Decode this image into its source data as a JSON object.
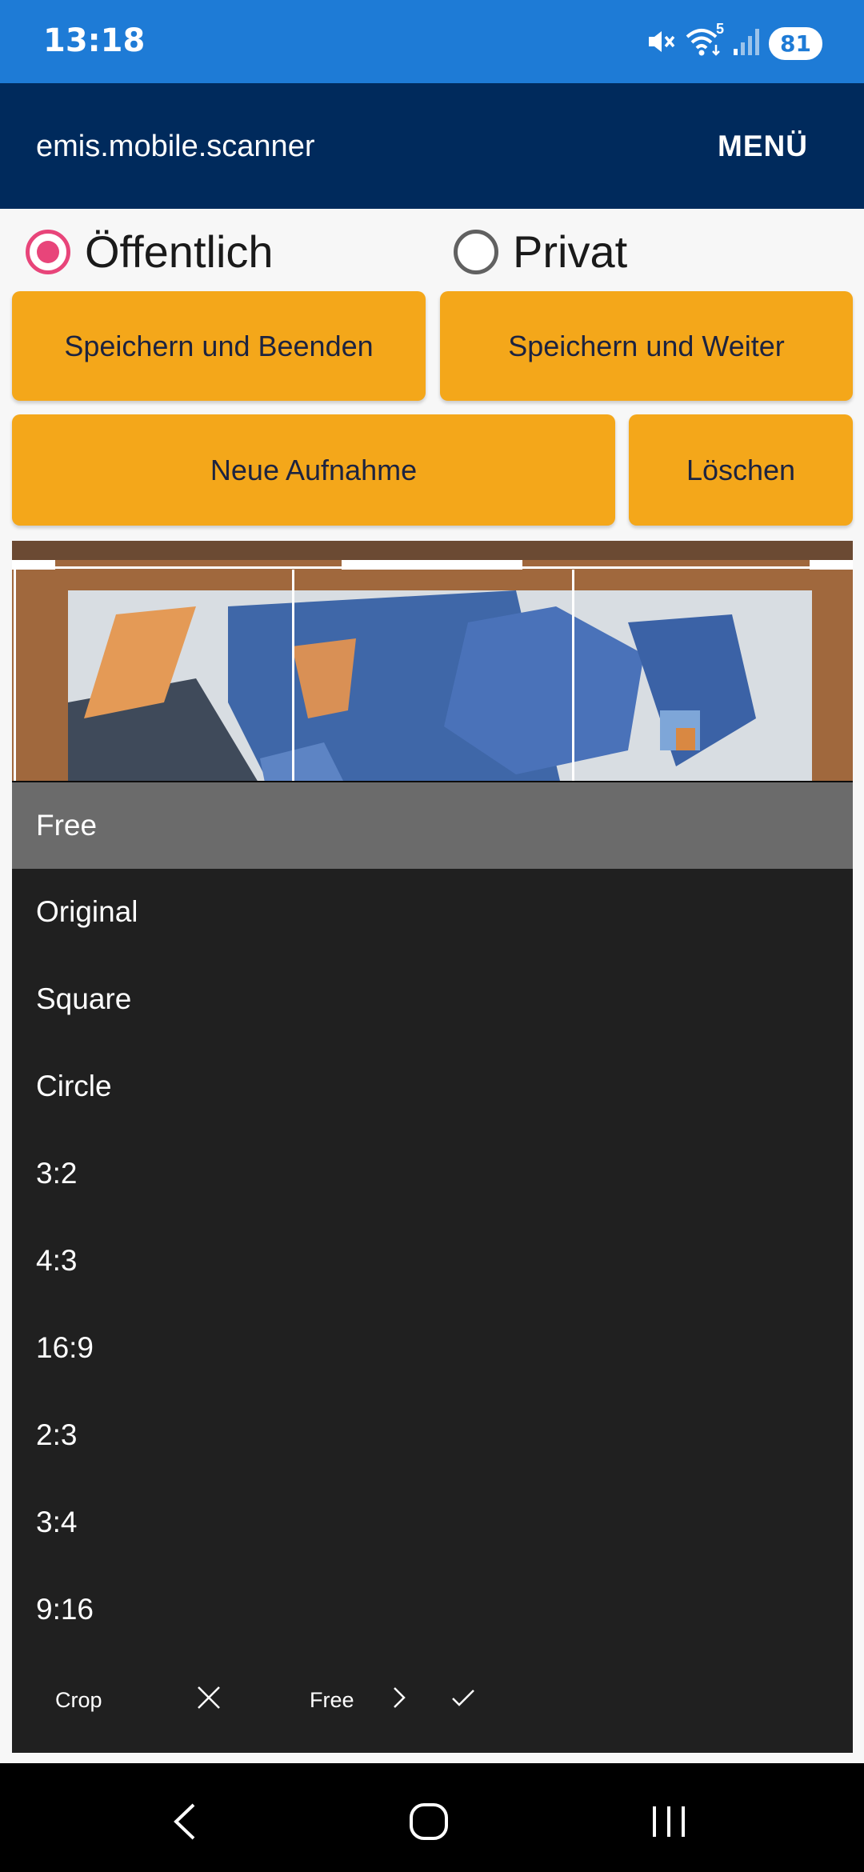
{
  "status_bar": {
    "time": "13:18",
    "battery": "81",
    "network": "5"
  },
  "app_bar": {
    "title": "emis.mobile.scanner",
    "menu_label": "MENÜ"
  },
  "visibility": {
    "options": [
      {
        "label": "Öffentlich",
        "selected": true
      },
      {
        "label": "Privat",
        "selected": false
      }
    ]
  },
  "actions": {
    "save_and_exit": "Speichern und Beenden",
    "save_and_next": "Speichern und Weiter",
    "new_capture": "Neue Aufnahme",
    "delete": "Löschen"
  },
  "crop_menu": {
    "options": [
      "Free",
      "Original",
      "Square",
      "Circle",
      "3:2",
      "4:3",
      "16:9",
      "2:3",
      "3:4",
      "9:16"
    ],
    "selected": "Free"
  },
  "crop_toolbar": {
    "crop_label": "Crop",
    "mode_label": "Free"
  },
  "colors": {
    "accent": "#f4a71a",
    "app_bar": "#002a5c",
    "status_bar": "#1e7bd6",
    "radio_checked": "#e8457a"
  },
  "icons": {
    "status": [
      "mute-icon",
      "wifi-icon",
      "signal-icon"
    ],
    "toolbar": [
      "close-icon",
      "chevron-right-icon",
      "check-icon"
    ],
    "navigation": [
      "back-icon",
      "home-icon",
      "recents-icon"
    ]
  }
}
